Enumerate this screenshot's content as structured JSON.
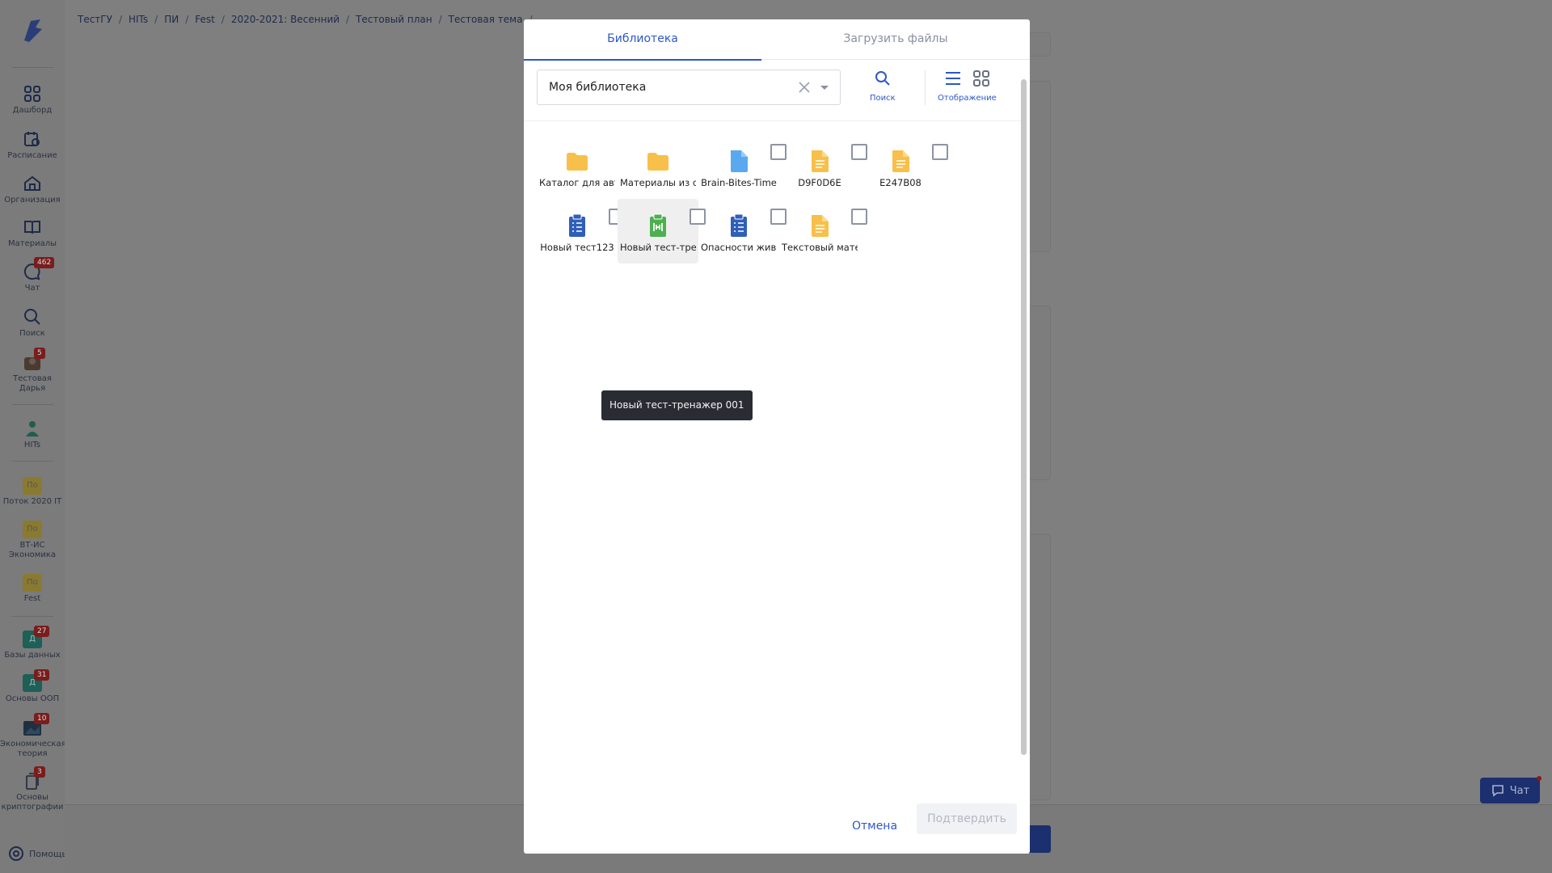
{
  "breadcrumb": [
    "ТестГУ",
    "HITs",
    "ПИ",
    "Fest",
    "2020-2021: Весенний",
    "Тестовый план",
    "Тестовая тема"
  ],
  "sidebar": {
    "items": [
      {
        "label": "Дашборд",
        "icon": "dashboard-icon"
      },
      {
        "label": "Расписание",
        "icon": "schedule-icon"
      },
      {
        "label": "Организация",
        "icon": "organization-icon"
      },
      {
        "label": "Материалы",
        "icon": "book-icon"
      },
      {
        "label": "Чат",
        "icon": "chat-icon",
        "badge": "462"
      },
      {
        "label": "Поиск",
        "icon": "search-icon"
      },
      {
        "label": "Тестовая Дарья",
        "icon": "avatar",
        "badge": "5"
      },
      {
        "label": "HITs",
        "icon": "hits-logo"
      },
      {
        "label": "Поток 2020 IT",
        "thumb": "Пo"
      },
      {
        "label": "ВТ-ИС Экономика",
        "thumb": "Пo"
      },
      {
        "label": "Fest",
        "thumb": "Пo"
      },
      {
        "label": "Базы данных",
        "thumb": "Д",
        "badge": "27"
      },
      {
        "label": "Основы ООП",
        "thumb": "Д",
        "badge": "31"
      },
      {
        "label": "Экономическая теория",
        "icon": "course-image",
        "badge": "10"
      },
      {
        "label": "Основы криптографии",
        "icon": "course-doc",
        "badge": "3"
      }
    ],
    "help_label": "Помощь"
  },
  "chat_float_label": "Чат",
  "modal": {
    "tabs": [
      {
        "label": "Библиотека",
        "active": true
      },
      {
        "label": "Загрузить файлы",
        "active": false
      }
    ],
    "library_select": {
      "value": "Моя библиотека"
    },
    "search_label": "Поиск",
    "view_label": "Отображение",
    "items": [
      {
        "name": "Каталог для авторов",
        "type": "folder"
      },
      {
        "name": "Материалы из общих",
        "type": "folder"
      },
      {
        "name": "Brain-Bites-Time",
        "type": "file-blue"
      },
      {
        "name": "D9F0D6E",
        "type": "doc-yellow"
      },
      {
        "name": "E247B08",
        "type": "doc-yellow"
      },
      {
        "name": "Новый тест123",
        "type": "test-blue"
      },
      {
        "name": "Новый тест-тренажер 001",
        "type": "trainer-green"
      },
      {
        "name": "Опасности живой природы",
        "type": "test-blue"
      },
      {
        "name": "Текстовый материал",
        "type": "doc-yellow"
      }
    ],
    "tooltip": "Новый тест-тренажер 001",
    "cancel_label": "Отмена",
    "confirm_label": "Подтвердить",
    "colors": {
      "accent": "#2c57c7",
      "folder": "#f7c04a",
      "doc": "#f7c04a",
      "file": "#5aa8f0",
      "test": "#2f5fb8",
      "trainer": "#4caf50"
    }
  }
}
